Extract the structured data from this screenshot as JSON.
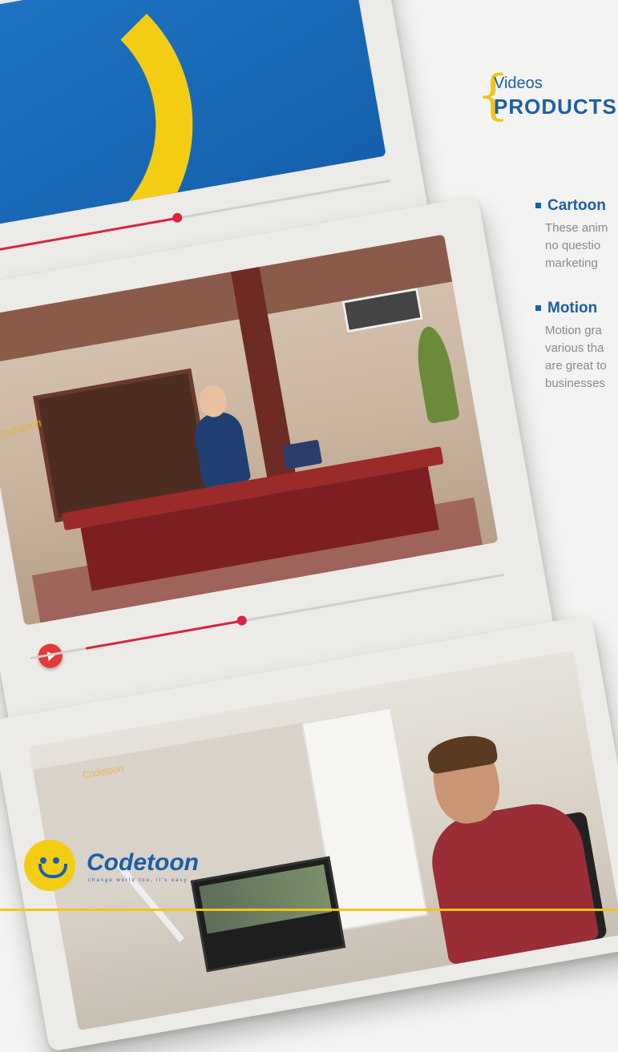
{
  "header": {
    "over_title": "Videos",
    "title": "PRODUCTS"
  },
  "services": [
    {
      "title": "Cartoon",
      "lines": [
        "These anim",
        "no questio",
        "marketing"
      ]
    },
    {
      "title": "Motion",
      "lines": [
        "Motion gra",
        "various tha",
        "are great to",
        "businesses"
      ]
    }
  ],
  "screens": {
    "office_watermark": "Codetoon",
    "editor_watermark": "Codetoon"
  },
  "logo": {
    "name": "Codetoon",
    "tagline": "change world too, it's easy"
  },
  "colors": {
    "brand_blue": "#1b5fa8",
    "brand_yellow": "#f3cd14",
    "accent_red": "#d7263d"
  }
}
